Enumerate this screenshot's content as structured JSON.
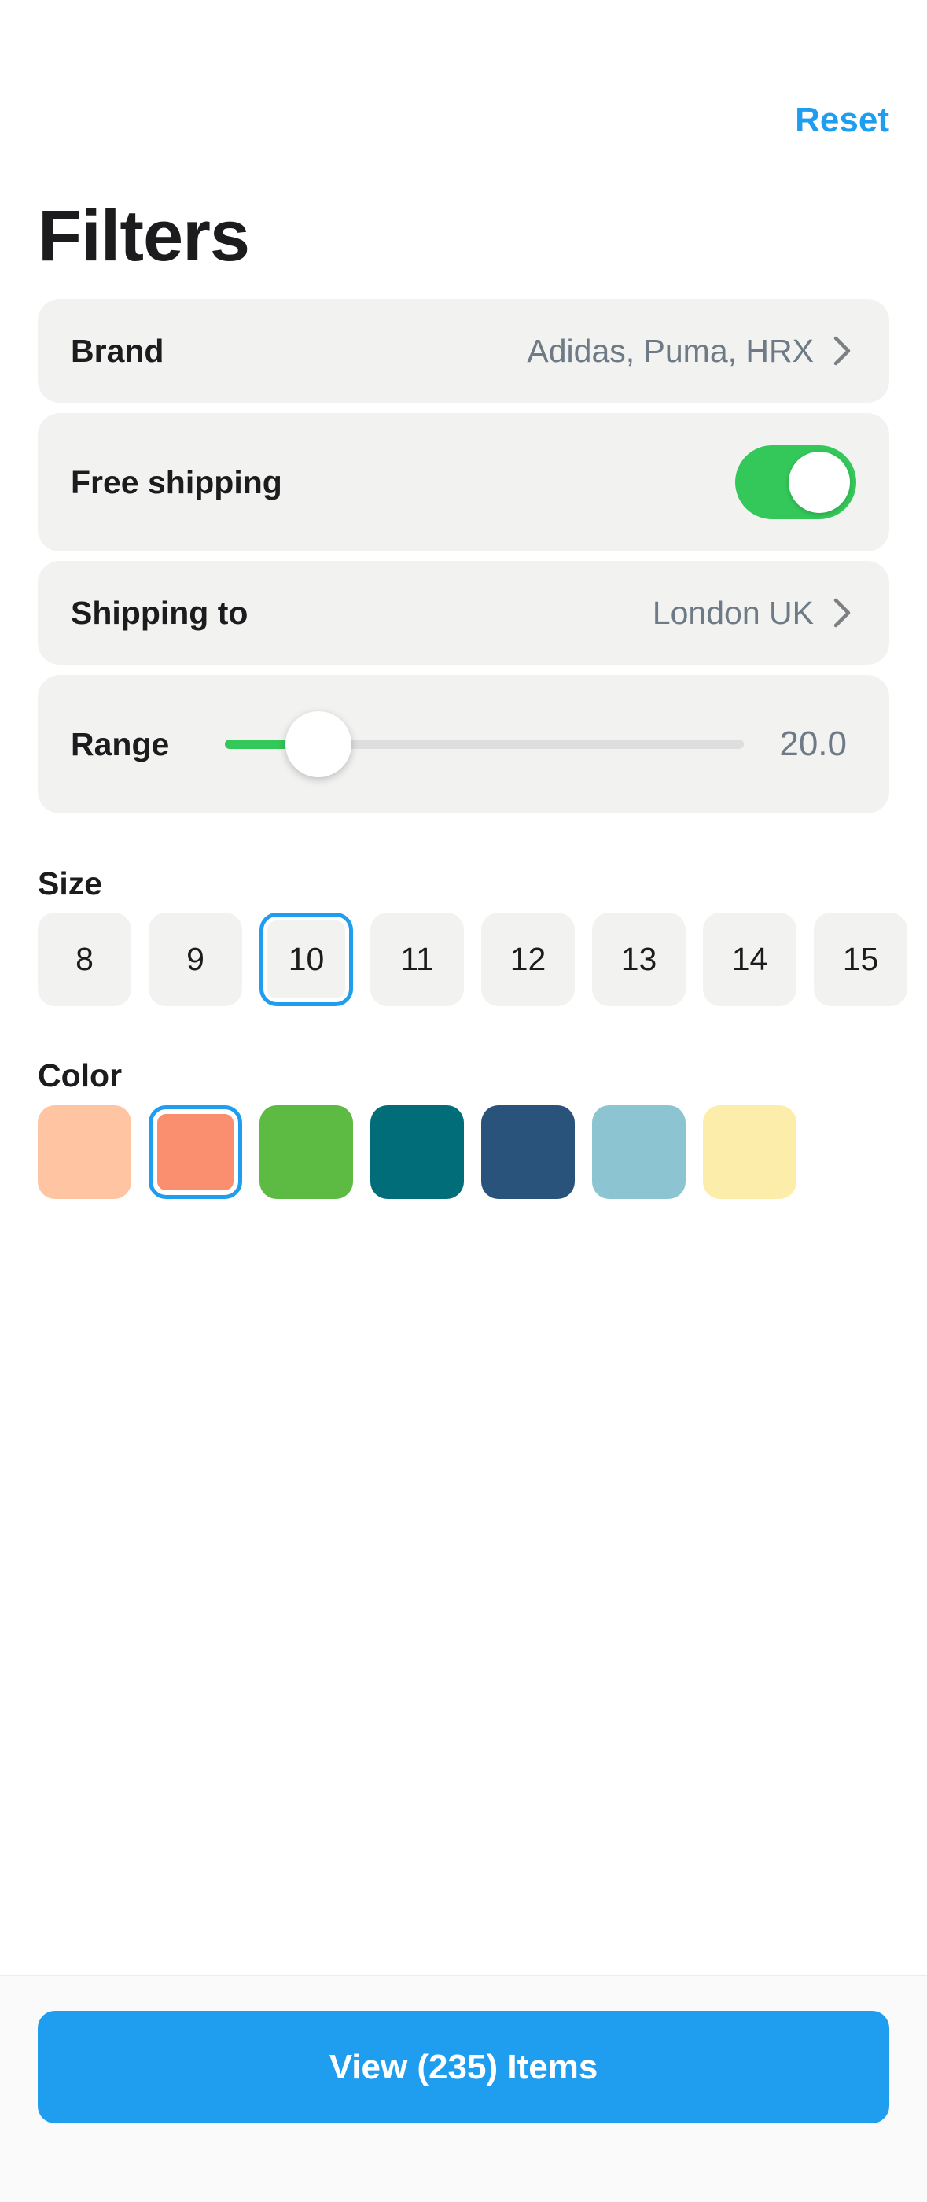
{
  "header": {
    "reset_label": "Reset",
    "title": "Filters"
  },
  "filters": {
    "brand": {
      "label": "Brand",
      "value": "Adidas, Puma, HRX"
    },
    "free_shipping": {
      "label": "Free shipping",
      "enabled": true
    },
    "shipping_to": {
      "label": "Shipping to",
      "value": "London UK"
    },
    "range": {
      "label": "Range",
      "value_text": "20.0",
      "fraction": 0.18
    }
  },
  "size": {
    "label": "Size",
    "options": [
      "8",
      "9",
      "10",
      "11",
      "12",
      "13",
      "14",
      "15"
    ],
    "selected": "10"
  },
  "color": {
    "label": "Color",
    "swatches": [
      "#ffc4a1",
      "#f98f6e",
      "#5dba43",
      "#006d78",
      "#2a537c",
      "#8dc4d1",
      "#fcedab"
    ],
    "selected_index": 1
  },
  "footer": {
    "view_button_label": "View (235) Items"
  },
  "colors": {
    "accent": "#1f9ef0",
    "toggle_on": "#34c759",
    "card_bg": "#f2f2f1"
  },
  "icons": {
    "chevron": "chevron-right-icon"
  }
}
